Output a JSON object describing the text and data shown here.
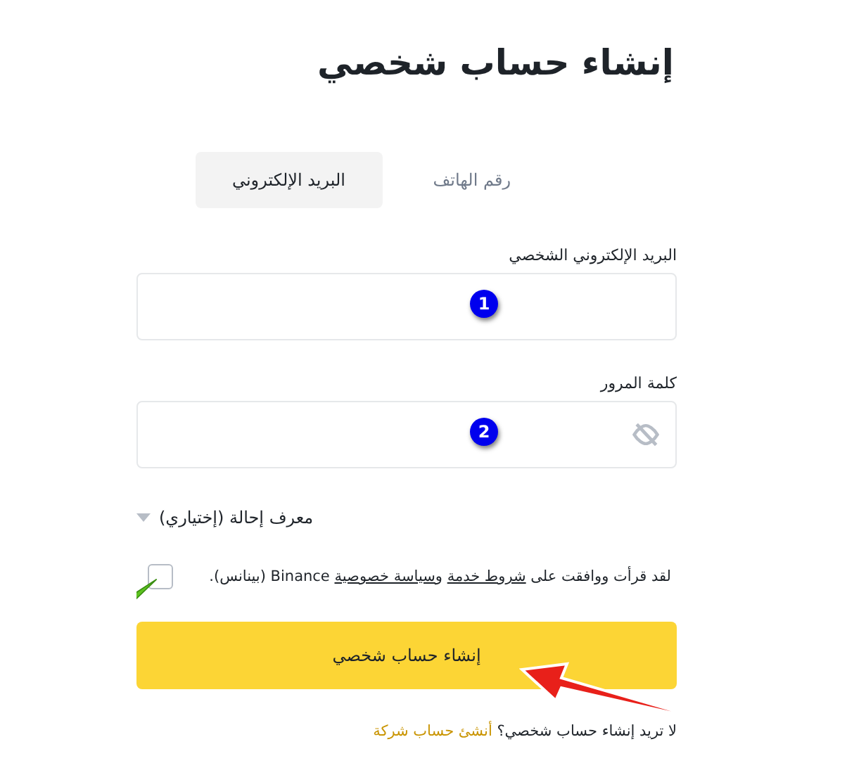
{
  "title": "إنشاء حساب شخصي",
  "tabs": [
    {
      "label": "رقم الهاتف",
      "selected": false
    },
    {
      "label": "البريد الإلكتروني",
      "selected": true
    }
  ],
  "fields": [
    {
      "label": "البريد الإلكتروني الشخصي",
      "kind": "text",
      "marker": "1"
    },
    {
      "label": "كلمة المرور",
      "kind": "password",
      "marker": "2"
    }
  ],
  "referral": {
    "label": "معرف إحالة (إختياري)",
    "expanded": false
  },
  "terms": {
    "checked": false,
    "parts": [
      {
        "kind": "text",
        "text": "لقد قرأت ووافقت على "
      },
      {
        "kind": "link",
        "text": "شروط خدمة"
      },
      {
        "kind": "text",
        "text": " و"
      },
      {
        "kind": "link",
        "text": "سياسة خصوصية"
      },
      {
        "kind": "text",
        "text": " Binance (بينانس)."
      }
    ]
  },
  "submit": "إنشاء حساب شخصي",
  "footer": {
    "text": "لا تريد إنشاء حساب شخصي؟",
    "link": "أنشئ حساب شركة"
  }
}
